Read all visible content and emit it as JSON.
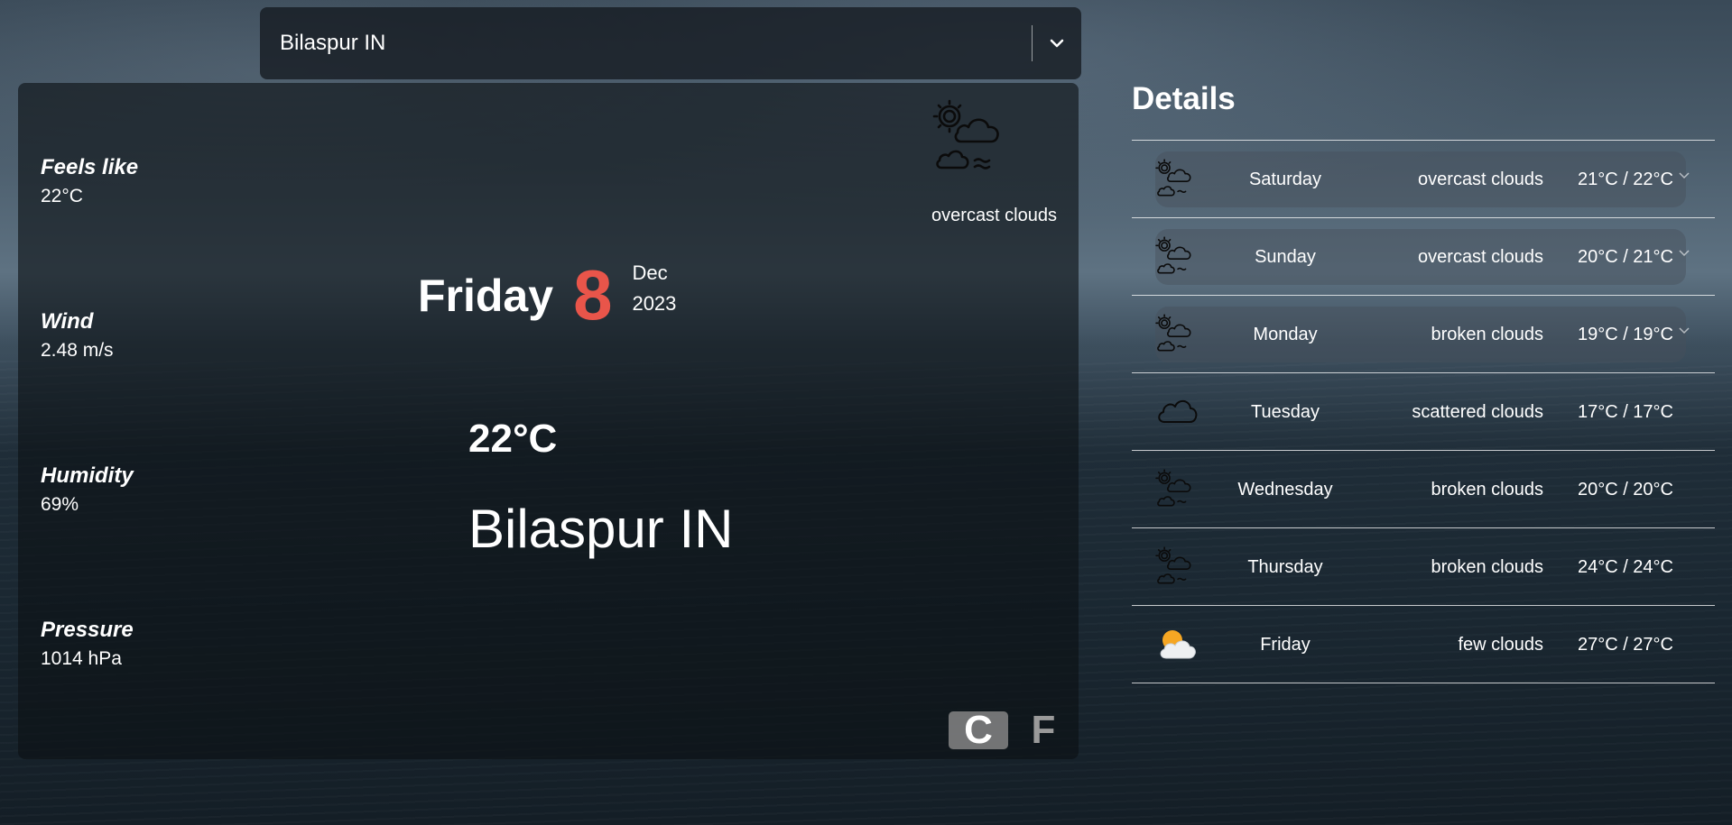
{
  "search": {
    "value": "Bilaspur IN",
    "icon": "chevron-down-icon"
  },
  "current": {
    "stats": [
      {
        "label": "Feels like",
        "value": "22°C"
      },
      {
        "label": "Wind",
        "value": "2.48 m/s"
      },
      {
        "label": "Humidity",
        "value": "69%"
      },
      {
        "label": "Pressure",
        "value": "1014 hPa"
      }
    ],
    "icon": "cloud-sun-icon",
    "description": "overcast clouds",
    "day": "Friday",
    "date_num": "8",
    "month": "Dec",
    "year": "2023",
    "temperature": "22°C",
    "city": "Bilaspur IN",
    "units": {
      "celsius": "C",
      "fahrenheit": "F",
      "selected": "C"
    }
  },
  "details": {
    "title": "Details",
    "rows": [
      {
        "day": "Saturday",
        "description": "overcast clouds",
        "temps": "21°C / 22°C",
        "icon": "cloud-sun-icon",
        "expandable": true
      },
      {
        "day": "Sunday",
        "description": "overcast clouds",
        "temps": "20°C / 21°C",
        "icon": "cloud-sun-icon",
        "expandable": true
      },
      {
        "day": "Monday",
        "description": "broken clouds",
        "temps": "19°C / 19°C",
        "icon": "cloud-sun-icon",
        "expandable": true
      },
      {
        "day": "Tuesday",
        "description": "scattered clouds",
        "temps": "17°C / 17°C",
        "icon": "cloud-icon",
        "expandable": false
      },
      {
        "day": "Wednesday",
        "description": "broken clouds",
        "temps": "20°C / 20°C",
        "icon": "cloud-sun-icon",
        "expandable": false
      },
      {
        "day": "Thursday",
        "description": "broken clouds",
        "temps": "24°C / 24°C",
        "icon": "cloud-sun-icon",
        "expandable": false
      },
      {
        "day": "Friday",
        "description": "few clouds",
        "temps": "27°C / 27°C",
        "icon": "sun-behind-cloud-icon",
        "expandable": false
      }
    ]
  },
  "colors": {
    "date_accent": "#e9554a",
    "unit_selected_bg": "#8c8c8c",
    "unit_unselected_text": "#9a9a9a"
  }
}
